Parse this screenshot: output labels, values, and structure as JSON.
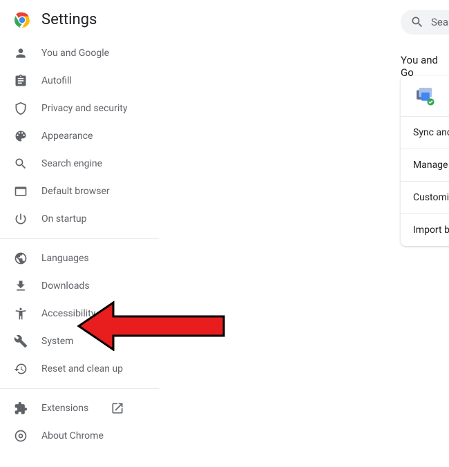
{
  "header": {
    "title": "Settings"
  },
  "search": {
    "placeholder": "Searc"
  },
  "sidebar": {
    "group1": [
      {
        "label": "You and Google"
      },
      {
        "label": "Autofill"
      },
      {
        "label": "Privacy and security"
      },
      {
        "label": "Appearance"
      },
      {
        "label": "Search engine"
      },
      {
        "label": "Default browser"
      },
      {
        "label": "On startup"
      }
    ],
    "group2": [
      {
        "label": "Languages"
      },
      {
        "label": "Downloads"
      },
      {
        "label": "Accessibility"
      },
      {
        "label": "System"
      },
      {
        "label": "Reset and clean up"
      }
    ],
    "group3": [
      {
        "label": "Extensions"
      },
      {
        "label": "About Chrome"
      }
    ]
  },
  "main": {
    "section_title": "You and Go",
    "rows": [
      {
        "label": "Sync and"
      },
      {
        "label": "Manage y"
      },
      {
        "label": "Customiz"
      },
      {
        "label": "Import bo"
      }
    ]
  }
}
